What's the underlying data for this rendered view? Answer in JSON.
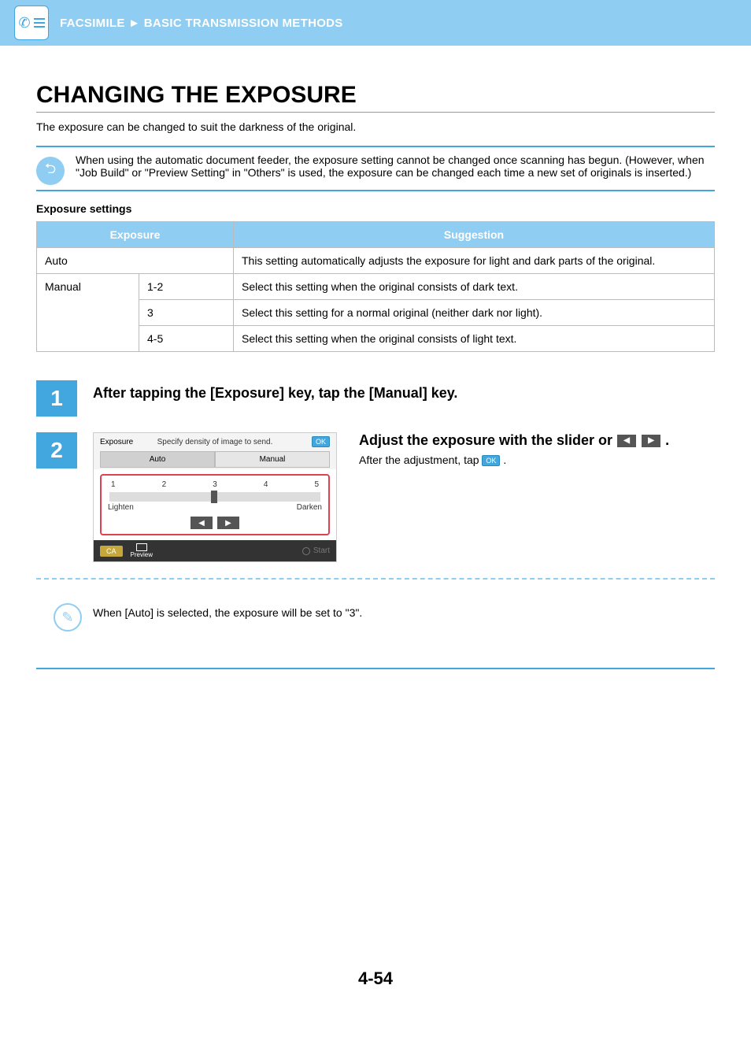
{
  "header": {
    "part1": "FACSIMILE",
    "sep": "►",
    "part2": "BASIC TRANSMISSION METHODS"
  },
  "title": "CHANGING THE EXPOSURE",
  "intro": "The exposure can be changed to suit the darkness of the original.",
  "info1": "When using the automatic document feeder, the exposure setting cannot be changed once scanning has begun. (However, when \"Job Build\" or \"Preview Setting\" in \"Others\" is used, the exposure can be changed each time a new set of originals is inserted.)",
  "tableTitle": "Exposure settings",
  "table": {
    "head": {
      "c1": "Exposure",
      "c2": "Suggestion"
    },
    "rows": {
      "auto": {
        "label": "Auto",
        "sugg": "This setting automatically adjusts the exposure for light and dark parts of the original."
      },
      "manualLabel": "Manual",
      "m12": {
        "range": "1-2",
        "sugg": "Select this setting when the original consists of dark text."
      },
      "m3": {
        "range": "3",
        "sugg": "Select this setting for a normal original (neither dark nor light)."
      },
      "m45": {
        "range": "4-5",
        "sugg": "Select this setting when the original consists of light text."
      }
    }
  },
  "steps": {
    "s1": {
      "num": "1",
      "title": "After tapping the [Exposure] key, tap the [Manual] key."
    },
    "s2": {
      "num": "2",
      "title_a": "Adjust the exposure with the slider or ",
      "title_b": ".",
      "after_a": "After the adjustment, tap ",
      "after_b": "."
    }
  },
  "screen": {
    "heading": "Exposure",
    "hint": "Specify density of image to send.",
    "ok": "OK",
    "tabAuto": "Auto",
    "tabManual": "Manual",
    "scale": {
      "n1": "1",
      "n2": "2",
      "n3": "3",
      "n4": "4",
      "n5": "5"
    },
    "lighten": "Lighten",
    "darken": "Darken",
    "ca": "CA",
    "preview": "Preview",
    "start": "Start"
  },
  "note": "When [Auto] is selected, the exposure will be set to \"3\".",
  "pageNumber": "4-54",
  "icons": {
    "back": "⮌",
    "pencil": "✎",
    "left": "◀",
    "right": "▶"
  }
}
